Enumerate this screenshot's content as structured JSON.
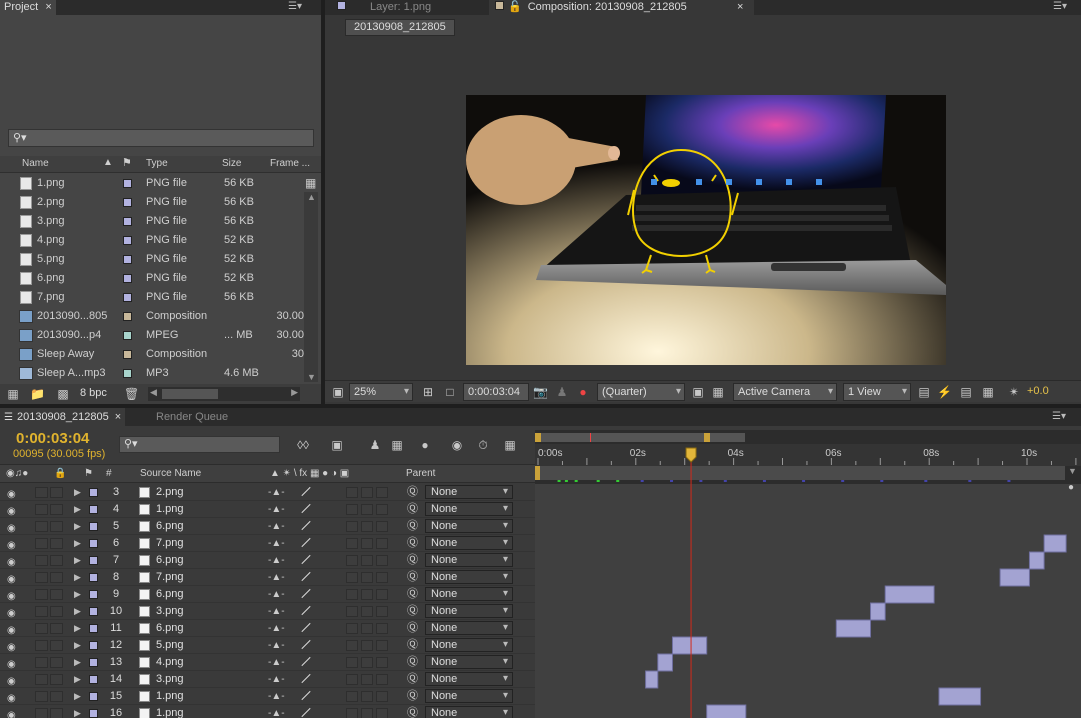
{
  "project_panel": {
    "tab_label": "Project",
    "search_placeholder": "",
    "columns": {
      "name": "Name",
      "type": "Type",
      "size": "Size",
      "frame": "Frame ..."
    },
    "items": [
      {
        "name": "1.png",
        "type": "PNG file",
        "size": "56 KB",
        "frame": "",
        "kind": "file",
        "color": "#b2b2e0"
      },
      {
        "name": "2.png",
        "type": "PNG file",
        "size": "56 KB",
        "frame": "",
        "kind": "file",
        "color": "#b2b2e0"
      },
      {
        "name": "3.png",
        "type": "PNG file",
        "size": "56 KB",
        "frame": "",
        "kind": "file",
        "color": "#b2b2e0"
      },
      {
        "name": "4.png",
        "type": "PNG file",
        "size": "52 KB",
        "frame": "",
        "kind": "file",
        "color": "#b2b2e0"
      },
      {
        "name": "5.png",
        "type": "PNG file",
        "size": "52 KB",
        "frame": "",
        "kind": "file",
        "color": "#b2b2e0"
      },
      {
        "name": "6.png",
        "type": "PNG file",
        "size": "52 KB",
        "frame": "",
        "kind": "file",
        "color": "#b2b2e0"
      },
      {
        "name": "7.png",
        "type": "PNG file",
        "size": "56 KB",
        "frame": "",
        "kind": "file",
        "color": "#b2b2e0"
      },
      {
        "name": "2013090...805",
        "type": "Composition",
        "size": "",
        "frame": "30.00",
        "kind": "comp",
        "color": "#c8b89a"
      },
      {
        "name": "2013090...p4",
        "type": "MPEG",
        "size": "... MB",
        "frame": "30.00",
        "kind": "comp",
        "color": "#a8d4cc"
      },
      {
        "name": "Sleep Away",
        "type": "Composition",
        "size": "",
        "frame": "30",
        "kind": "comp",
        "color": "#c8b89a"
      },
      {
        "name": "Sleep A...mp3",
        "type": "MP3",
        "size": "4.6 MB",
        "frame": "",
        "kind": "audio",
        "color": "#a8d4cc"
      }
    ],
    "bpc": "8 bpc"
  },
  "viewer": {
    "layer_tab": "Layer: 1.png",
    "comp_tab": "Composition: 20130908_212805",
    "comp_chip": "20130908_212805",
    "zoom": "25%",
    "timecode": "0:00:03:04",
    "resolution": "(Quarter)",
    "camera": "Active Camera",
    "views": "1 View",
    "exposure": "+0.0"
  },
  "timeline": {
    "comp_tab": "20130908_212805",
    "render_queue_tab": "Render Queue",
    "current_time": "0:00:03:04",
    "frame_info": "00095 (30.005 fps)",
    "search_placeholder": "",
    "col_num": "#",
    "col_source": "Source Name",
    "col_parent": "Parent",
    "ruler": [
      {
        "label": "0:00s",
        "x": 0
      },
      {
        "label": "02s",
        "x": 2
      },
      {
        "label": "04s",
        "x": 4
      },
      {
        "label": "06s",
        "x": 6
      },
      {
        "label": "08s",
        "x": 8
      },
      {
        "label": "10s",
        "x": 10
      }
    ],
    "current_seconds": 3.13,
    "layers": [
      {
        "num": "3",
        "name": "2.png",
        "parent": "None",
        "start": null,
        "end": null
      },
      {
        "num": "4",
        "name": "1.png",
        "parent": "None",
        "start": null,
        "end": null
      },
      {
        "num": "5",
        "name": "6.png",
        "parent": "None",
        "start": null,
        "end": null
      },
      {
        "num": "6",
        "name": "7.png",
        "parent": "None",
        "start": 10.35,
        "end": 10.8
      },
      {
        "num": "7",
        "name": "6.png",
        "parent": "None",
        "start": 10.05,
        "end": 10.35
      },
      {
        "num": "8",
        "name": "7.png",
        "parent": "None",
        "start": 9.45,
        "end": 10.05
      },
      {
        "num": "9",
        "name": "6.png",
        "parent": "None",
        "start": 7.1,
        "end": 8.1
      },
      {
        "num": "10",
        "name": "3.png",
        "parent": "None",
        "start": 6.8,
        "end": 7.1
      },
      {
        "num": "11",
        "name": "6.png",
        "parent": "None",
        "start": 6.1,
        "end": 6.8
      },
      {
        "num": "12",
        "name": "5.png",
        "parent": "None",
        "start": 2.75,
        "end": 3.45
      },
      {
        "num": "13",
        "name": "4.png",
        "parent": "None",
        "start": 2.45,
        "end": 2.75
      },
      {
        "num": "14",
        "name": "3.png",
        "parent": "None",
        "start": 2.2,
        "end": 2.45
      },
      {
        "num": "15",
        "name": "1.png",
        "parent": "None",
        "start": 8.2,
        "end": 9.05
      },
      {
        "num": "16",
        "name": "1.png",
        "parent": "None",
        "start": 3.45,
        "end": 4.25
      }
    ]
  }
}
